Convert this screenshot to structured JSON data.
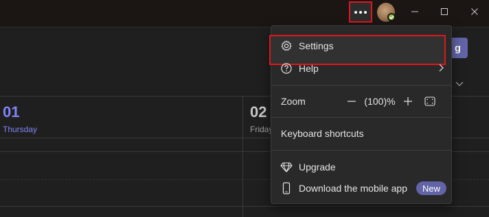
{
  "titlebar": {
    "more_icon": "more-horizontal-icon",
    "avatar_icon": "user-avatar",
    "presence_status": "available",
    "window_controls": [
      "minimize-icon",
      "maximize-icon",
      "close-icon"
    ]
  },
  "background": {
    "primary_button_fragment": "g",
    "days": [
      {
        "number": "01",
        "name": "Thursday"
      },
      {
        "number": "02",
        "name": "Friday"
      }
    ]
  },
  "menu": {
    "settings": {
      "label": "Settings",
      "icon": "gear-icon"
    },
    "help": {
      "label": "Help",
      "icon": "question-circle-icon"
    },
    "zoom": {
      "label": "Zoom",
      "value": "(100)%"
    },
    "shortcuts": {
      "label": "Keyboard shortcuts"
    },
    "upgrade": {
      "label": "Upgrade",
      "icon": "diamond-icon"
    },
    "download": {
      "label": "Download the mobile app",
      "icon": "mobile-phone-icon",
      "badge": "New"
    }
  },
  "colors": {
    "accent": "#6264a7",
    "highlight": "#e0161d",
    "today": "#7f85f5",
    "presence": "#92c353"
  }
}
